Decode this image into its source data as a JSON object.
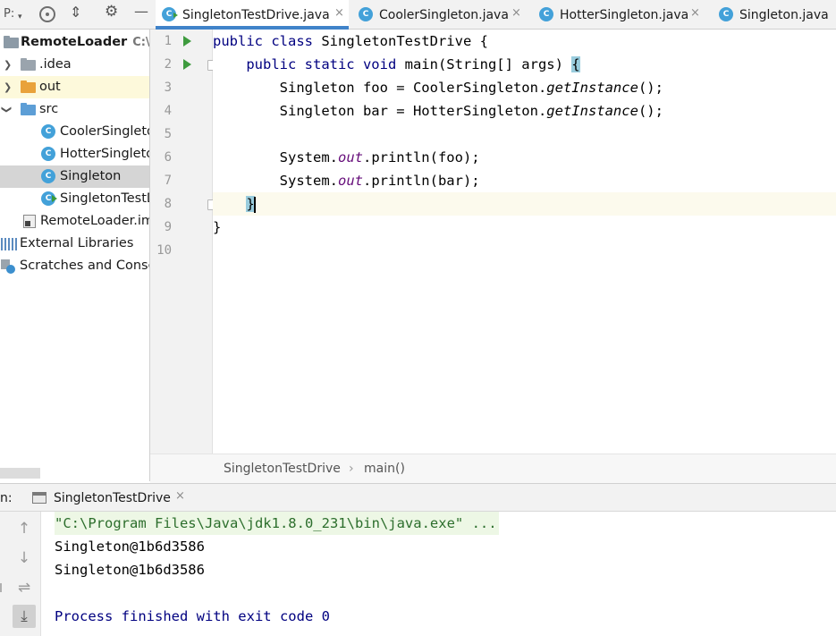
{
  "project_toolbar": {
    "label": "P:",
    "caret": "▾",
    "icons": [
      "locate-icon",
      "collapse-all-icon",
      "gear-icon",
      "minimize-icon"
    ]
  },
  "project_tree": {
    "root": {
      "name": "RemoteLoader",
      "path": "C:\\U"
    },
    "items": [
      {
        "label": ".idea",
        "icon": "folder-icon"
      },
      {
        "label": "out",
        "icon": "folder-icon"
      },
      {
        "label": "src",
        "icon": "folder-icon"
      },
      {
        "label": "CoolerSingleto",
        "icon": "class-icon"
      },
      {
        "label": "HotterSingleto",
        "icon": "class-icon"
      },
      {
        "label": "Singleton",
        "icon": "class-icon"
      },
      {
        "label": "SingletonTestD",
        "icon": "runnable-class-icon"
      },
      {
        "label": "RemoteLoader.iml",
        "icon": "module-file-icon"
      },
      {
        "label": "External Libraries",
        "icon": "libraries-icon"
      },
      {
        "label": "Scratches and Consol",
        "icon": "scratches-icon"
      }
    ]
  },
  "editor_tabs": [
    {
      "label": "SingletonTestDrive.java",
      "close": "×",
      "active": true
    },
    {
      "label": "CoolerSingleton.java",
      "close": "×",
      "active": false
    },
    {
      "label": "HotterSingleton.java",
      "close": "×",
      "active": false
    },
    {
      "label": "Singleton.java",
      "close": "",
      "active": false
    }
  ],
  "editor": {
    "line_numbers": [
      "1",
      "2",
      "3",
      "4",
      "5",
      "6",
      "7",
      "8",
      "9",
      "10"
    ],
    "lines": [
      [
        "public class ",
        "SingletonTestDrive {"
      ],
      [
        "    public static void ",
        "main(String[] args) ",
        "{"
      ],
      [
        "        Singleton foo = CoolerSingleton.",
        "getInstance",
        "();"
      ],
      [
        "        Singleton bar = HotterSingleton.",
        "getInstance",
        "();"
      ],
      [
        ""
      ],
      [
        "        System.",
        "out",
        ".println(foo);"
      ],
      [
        "        System.",
        "out",
        ".println(bar);"
      ],
      [
        "    ",
        "}"
      ],
      [
        "}"
      ],
      [
        ""
      ]
    ]
  },
  "breadcrumb": {
    "items": [
      "SingletonTestDrive",
      "main()"
    ],
    "separator": "›"
  },
  "run_panel": {
    "label": "n:",
    "tab": {
      "label": "SingletonTestDrive",
      "close": "×"
    },
    "side_buttons": [
      {
        "icon": "arrow-up-icon",
        "glyph": "↑"
      },
      {
        "icon": "arrow-down-icon",
        "glyph": "↓"
      },
      {
        "icon": "soft-wrap-icon",
        "glyph": "⇌"
      },
      {
        "icon": "scroll-to-end-icon",
        "glyph": "⤓"
      }
    ],
    "console": [
      "\"C:\\Program Files\\Java\\jdk1.8.0_231\\bin\\java.exe\" ...",
      "Singleton@1b6d3586",
      "Singleton@1b6d3586",
      "",
      "Process finished with exit code 0"
    ]
  }
}
